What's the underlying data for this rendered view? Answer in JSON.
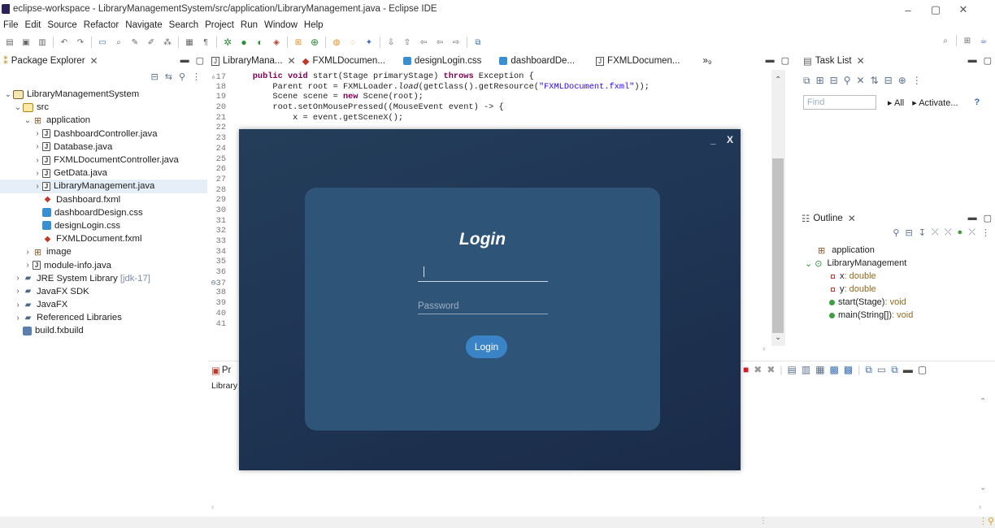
{
  "window": {
    "title": "eclipse-workspace - LibraryManagementSystem/src/application/LibraryManagement.java - Eclipse IDE",
    "controls": [
      "–",
      "▢",
      "✕"
    ]
  },
  "menu": [
    "File",
    "Edit",
    "Source",
    "Refactor",
    "Navigate",
    "Search",
    "Project",
    "Run",
    "Window",
    "Help"
  ],
  "package_explorer": {
    "tab_label": "Package Explorer",
    "tree": [
      {
        "label": "LibraryManagementSystem",
        "arrow": "⌄",
        "icon": "project-icon",
        "depth": 0
      },
      {
        "label": "src",
        "arrow": "⌄",
        "icon": "source-folder-icon",
        "depth": 1
      },
      {
        "label": "application",
        "arrow": "⌄",
        "icon": "package-icon",
        "depth": 2
      },
      {
        "label": "DashboardController.java",
        "arrow": "›",
        "icon": "java-file-icon",
        "depth": 3
      },
      {
        "label": "Database.java",
        "arrow": "›",
        "icon": "java-file-icon",
        "depth": 3
      },
      {
        "label": "FXMLDocumentController.java",
        "arrow": "›",
        "icon": "java-file-icon",
        "depth": 3
      },
      {
        "label": "GetData.java",
        "arrow": "›",
        "icon": "java-file-icon",
        "depth": 3
      },
      {
        "label": "LibraryManagement.java",
        "arrow": "›",
        "icon": "java-file-icon",
        "depth": 3,
        "selected": true
      },
      {
        "label": "Dashboard.fxml",
        "arrow": "",
        "icon": "fxml-file-icon",
        "depth": 3
      },
      {
        "label": "dashboardDesign.css",
        "arrow": "",
        "icon": "css-file-icon",
        "depth": 3
      },
      {
        "label": "designLogin.css",
        "arrow": "",
        "icon": "css-file-icon",
        "depth": 3
      },
      {
        "label": "FXMLDocument.fxml",
        "arrow": "",
        "icon": "fxml-file-icon",
        "depth": 3
      },
      {
        "label": "image",
        "arrow": "›",
        "icon": "package-icon",
        "depth": 2
      },
      {
        "label": "module-info.java",
        "arrow": "›",
        "icon": "java-file-icon",
        "depth": 2
      },
      {
        "label": "JRE System Library",
        "suffix": "[jdk-17]",
        "arrow": "›",
        "icon": "library-icon",
        "depth": 1
      },
      {
        "label": "JavaFX SDK",
        "arrow": "›",
        "icon": "library-icon",
        "depth": 1
      },
      {
        "label": "JavaFX",
        "arrow": "›",
        "icon": "library-icon",
        "depth": 1
      },
      {
        "label": "Referenced Libraries",
        "arrow": "›",
        "icon": "library-icon",
        "depth": 1
      },
      {
        "label": "build.fxbuild",
        "arrow": "",
        "icon": "build-file-icon",
        "depth": 1
      }
    ]
  },
  "editor": {
    "tabs": [
      "LibraryMana...",
      "FXMLDocumen...",
      "designLogin.css",
      "dashboardDe...",
      "FXMLDocumen...",
      "»₉"
    ],
    "lines": [
      {
        "n": "17",
        "marker": "▵",
        "parts": [
          [
            "",
            "    "
          ],
          [
            "kw",
            "public void"
          ],
          [
            "",
            " start(Stage primaryStage) "
          ],
          [
            "kw",
            "throws"
          ],
          [
            "",
            " Exception {"
          ]
        ]
      },
      {
        "n": "18",
        "parts": [
          [
            "",
            "        Parent root = FXMLLoader."
          ],
          [
            "it",
            "load"
          ],
          [
            "",
            "(getClass().getResource("
          ],
          [
            "str",
            "\"FXMLDocument.fxml\""
          ],
          [
            "",
            "));"
          ]
        ]
      },
      {
        "n": "19",
        "parts": [
          [
            "",
            "        Scene scene = "
          ],
          [
            "kw",
            "new"
          ],
          [
            "",
            " Scene(root);"
          ]
        ]
      },
      {
        "n": "20",
        "parts": [
          [
            "",
            "        root.setOnMousePressed((MouseEvent event) -> {"
          ]
        ]
      },
      {
        "n": "21",
        "parts": [
          [
            "",
            "            x = event.getSceneX();"
          ]
        ]
      },
      {
        "n": "22",
        "parts": [
          [
            "",
            ""
          ]
        ]
      },
      {
        "n": "23",
        "parts": [
          [
            "",
            ""
          ]
        ]
      },
      {
        "n": "24",
        "parts": [
          [
            "",
            ""
          ]
        ]
      },
      {
        "n": "25",
        "parts": [
          [
            "",
            ""
          ]
        ]
      },
      {
        "n": "26",
        "parts": [
          [
            "",
            ""
          ]
        ]
      },
      {
        "n": "27",
        "parts": [
          [
            "",
            ""
          ]
        ]
      },
      {
        "n": "28",
        "parts": [
          [
            "",
            ""
          ]
        ]
      },
      {
        "n": "29",
        "parts": [
          [
            "",
            ""
          ]
        ]
      },
      {
        "n": "30",
        "parts": [
          [
            "",
            ""
          ]
        ]
      },
      {
        "n": "31",
        "parts": [
          [
            "",
            ""
          ]
        ]
      },
      {
        "n": "32",
        "parts": [
          [
            "",
            ""
          ]
        ]
      },
      {
        "n": "33",
        "parts": [
          [
            "",
            ""
          ]
        ]
      },
      {
        "n": "34",
        "parts": [
          [
            "",
            ""
          ]
        ]
      },
      {
        "n": "35",
        "parts": [
          [
            "",
            ""
          ]
        ]
      },
      {
        "n": "36",
        "parts": [
          [
            "",
            ""
          ]
        ]
      },
      {
        "n": "37",
        "marker": "⊖",
        "parts": [
          [
            "",
            ""
          ]
        ]
      },
      {
        "n": "38",
        "parts": [
          [
            "",
            ""
          ]
        ]
      },
      {
        "n": "39",
        "parts": [
          [
            "",
            ""
          ]
        ]
      },
      {
        "n": "40",
        "parts": [
          [
            "",
            ""
          ]
        ]
      },
      {
        "n": "41",
        "parts": [
          [
            "",
            ""
          ]
        ]
      }
    ]
  },
  "console": {
    "tab_label": "Pr",
    "content": "Library"
  },
  "task_list": {
    "tab_label": "Task List",
    "find_placeholder": "Find",
    "all_label": "All",
    "activate_label": "Activate...",
    "help_glyph": "?"
  },
  "outline": {
    "tab_label": "Outline",
    "items": [
      {
        "label": "application",
        "type": "",
        "icon": "package-icon",
        "depth": 0
      },
      {
        "label": "LibraryManagement",
        "type": "",
        "icon": "class-icon",
        "depth": 0
      },
      {
        "label": "x",
        "type": " : double",
        "icon": "field-icon",
        "depth": 1
      },
      {
        "label": "y",
        "type": " : double",
        "icon": "field-icon",
        "depth": 1
      },
      {
        "label": "start(Stage)",
        "type": " : void",
        "icon": "public-method-icon",
        "depth": 1
      },
      {
        "label": "main(String[])",
        "type": " : void",
        "icon": "static-method-icon",
        "depth": 1
      }
    ]
  },
  "login": {
    "minimize_label": "_",
    "close_label": "X",
    "title": "Login",
    "username_value": "",
    "password_placeholder": "Password",
    "button_label": "Login",
    "colors": {
      "window": "#1f3654",
      "card": "#2e5477",
      "button": "#3a83c6"
    }
  }
}
